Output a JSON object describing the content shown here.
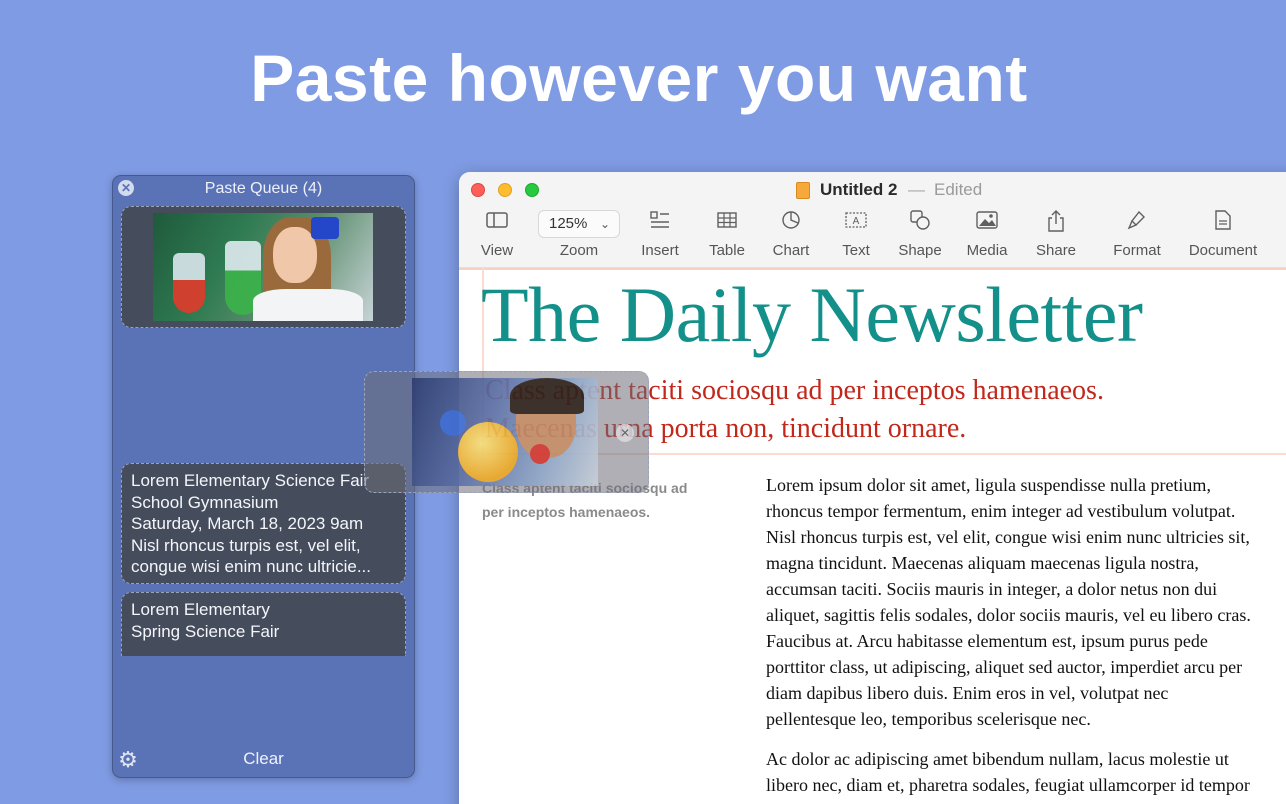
{
  "headline": "Paste however you want",
  "queue": {
    "title": "Paste Queue (4)",
    "close_icon": "x-circle-icon",
    "items": [
      {
        "type": "image",
        "subject": "girl-with-science-flasks"
      },
      {
        "type": "text",
        "lines": [
          "Lorem Elementary Science Fair",
          "School Gymnasium",
          "Saturday, March 18, 2023 9am",
          "Nisl rhoncus turpis est, vel elit,",
          "congue wisi enim nunc ultricie..."
        ]
      },
      {
        "type": "text",
        "lines": [
          "Lorem Elementary",
          "Spring Science Fair"
        ]
      }
    ],
    "settings_icon": "gear-icon",
    "clear_label": "Clear"
  },
  "window": {
    "doc_title": "Untitled 2",
    "separator": "—",
    "status": "Edited",
    "toolbar": [
      {
        "label": "View",
        "icon": "sidebar-icon"
      },
      {
        "label": "Zoom",
        "value": "125%"
      },
      {
        "label": "Insert",
        "icon": "insert-icon"
      },
      {
        "label": "Table",
        "icon": "table-icon"
      },
      {
        "label": "Chart",
        "icon": "chart-icon"
      },
      {
        "label": "Text",
        "icon": "text-box-icon"
      },
      {
        "label": "Shape",
        "icon": "shape-icon"
      },
      {
        "label": "Media",
        "icon": "media-icon"
      },
      {
        "label": "Share",
        "icon": "share-icon"
      },
      {
        "label": "Format",
        "icon": "paintbrush-icon"
      },
      {
        "label": "Document",
        "icon": "document-icon"
      }
    ],
    "colors": {
      "title": "#14908a",
      "subtitle": "#c1271a"
    }
  },
  "document": {
    "title": "The Daily Newsletter",
    "subtitle_lines": [
      "Class aptent taciti sociosqu ad per inceptos hamenaeos.",
      "Maecenas urna porta non, tincidunt ornare."
    ],
    "pull_quote_lines": [
      "Class aptent taciti sociosqu ad",
      "per inceptos hamenaeos."
    ],
    "body_paragraphs": [
      [
        "Lorem ipsum dolor sit amet, ligula suspendisse nulla pretium,",
        "rhoncus tempor fermentum, enim integer ad vestibulum volutpat.",
        "Nisl rhoncus turpis est, vel elit, congue wisi enim nunc ultricies sit,",
        "magna tincidunt. Maecenas aliquam maecenas ligula nostra,",
        "accumsan taciti. Sociis mauris in integer, a dolor netus non dui",
        "aliquet, sagittis felis sodales, dolor sociis mauris, vel eu libero cras.",
        "Faucibus at. Arcu habitasse elementum est, ipsum purus pede",
        "porttitor class, ut adipiscing, aliquet sed auctor, imperdiet arcu per",
        "diam dapibus libero duis. Enim eros in vel, volutpat nec",
        "pellentesque leo, temporibus scelerisque nec."
      ],
      [
        "Ac dolor ac adipiscing amet bibendum nullam, lacus molestie ut",
        "libero nec, diam et, pharetra sodales, feugiat ullamcorper id tempor"
      ]
    ]
  },
  "drag_preview": {
    "subject": "boy-with-planet-model",
    "close_icon": "x-circle-icon"
  }
}
